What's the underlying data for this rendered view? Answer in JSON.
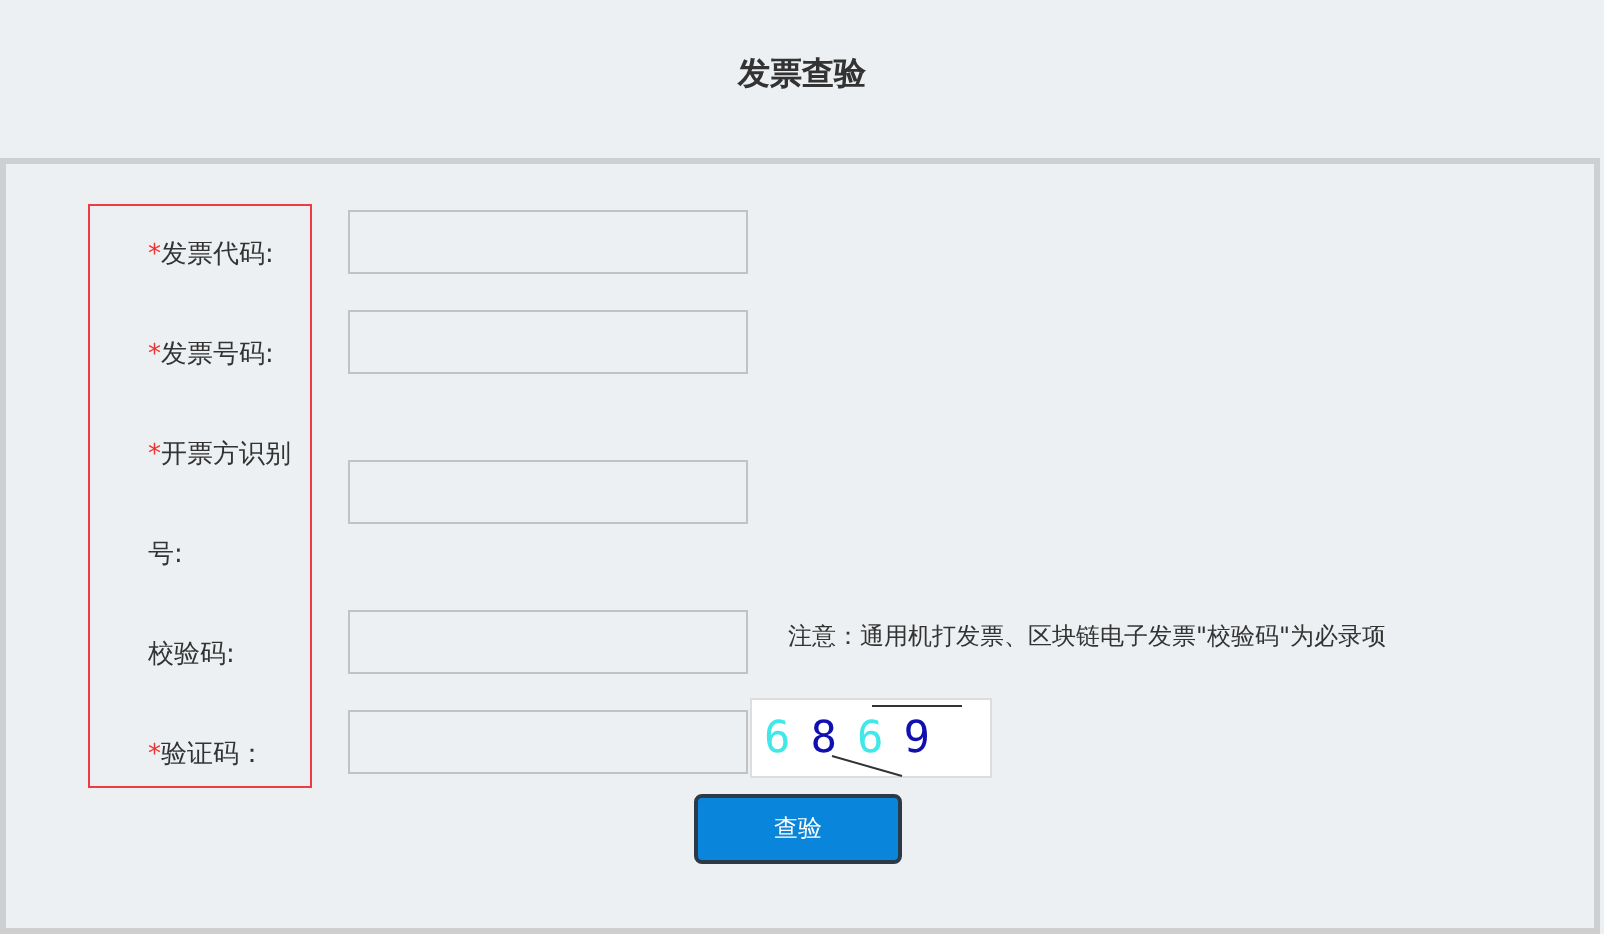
{
  "page": {
    "title": "发票查验"
  },
  "fields": [
    {
      "marker": "*",
      "label": "发票代码:"
    },
    {
      "marker": "*",
      "label": "发票号码:"
    },
    {
      "marker": "*",
      "label": "开票方识别号:"
    },
    {
      "label": "校验码:",
      "note": "注意：通用机打发票、区块链电子发票\"校验码\"为必录项"
    },
    {
      "marker": "*",
      "label": "验证码：",
      "captcha": [
        {
          "text": "6",
          "color": "#40e8e8"
        },
        {
          "text": "8",
          "color": "#1010b0"
        },
        {
          "text": "6",
          "color": "#40e8e8"
        },
        {
          "text": "9",
          "color": "#1010b0"
        }
      ]
    }
  ],
  "submit": "查验"
}
